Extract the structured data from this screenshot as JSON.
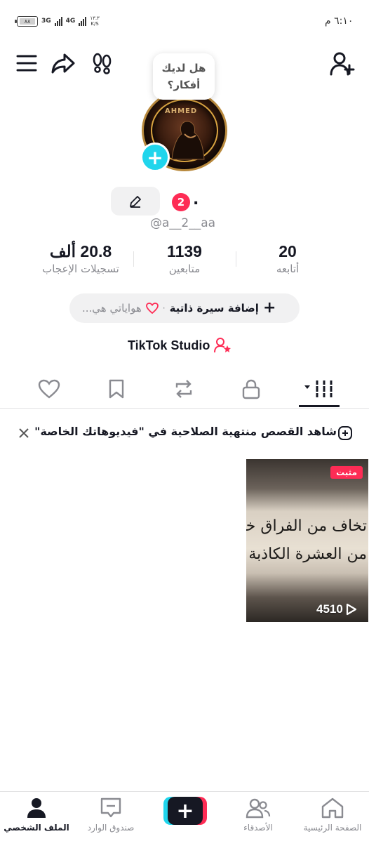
{
  "status_bar": {
    "time": "٦:١٠ م",
    "battery": "٨٨",
    "network_1": "3G",
    "network_2": "4G",
    "speed_value": "١٣.٣",
    "speed_unit": "K/S"
  },
  "header": {
    "ideas_bubble": "هل لديك أفكار؟"
  },
  "profile": {
    "avatar_caption": "AHMED",
    "notification_count": "2",
    "display_name": ".",
    "username": "@a__2__aa"
  },
  "stats": [
    {
      "value": "20.8 ألف",
      "label": "تسجيلات الإعجاب"
    },
    {
      "value": "1139",
      "label": "متابعين"
    },
    {
      "value": "20",
      "label": "أتابعه"
    }
  ],
  "bio": {
    "add_bio": "إضافة سيرة ذاتية",
    "separator": "·",
    "hobbies": "هواياتي هي..."
  },
  "studio_link": "TikTok Studio",
  "stories_banner": "شاهد القصص منتهية الصلاحية في \"فيديوهاتك الخاصة\"",
  "video": {
    "pinned_label": "مثبت",
    "overlay_line1": "تخاف من الفراق خاف",
    "overlay_line2": "من العشرة الكاذبة",
    "play_count": "4510"
  },
  "bottom_nav": [
    {
      "label": "الصفحة الرئيسية",
      "icon": "home-icon"
    },
    {
      "label": "الأصدقاء",
      "icon": "friends-icon"
    },
    {
      "label": "",
      "icon": "plus-icon"
    },
    {
      "label": "صندوق الوارد",
      "icon": "inbox-icon"
    },
    {
      "label": "الملف الشخصي",
      "icon": "profile-icon"
    }
  ],
  "colors": {
    "accent_red": "#fe2c55",
    "accent_cyan": "#20d5ec",
    "text_primary": "#161823",
    "text_secondary": "#8a8b91"
  }
}
